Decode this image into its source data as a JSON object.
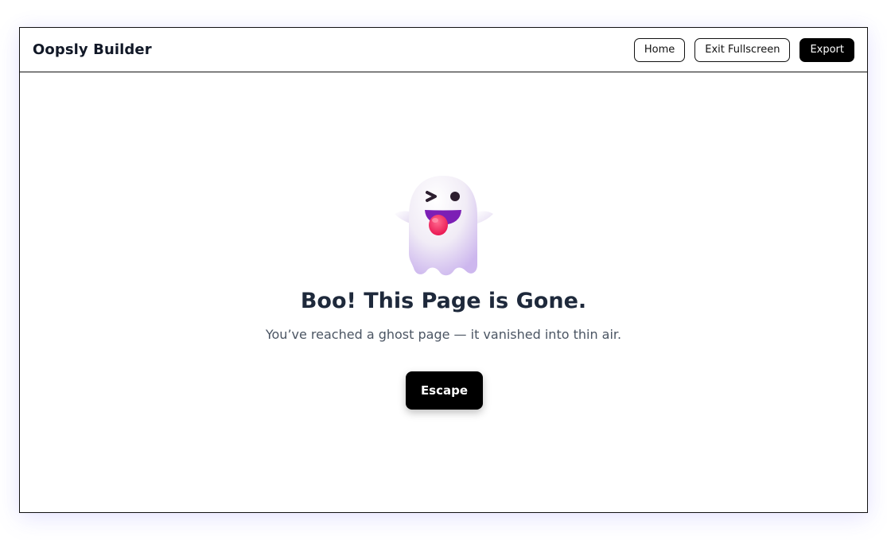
{
  "header": {
    "brand": "Oopsly Builder",
    "nav": {
      "home_label": "Home",
      "exit_fullscreen_label": "Exit Fullscreen",
      "export_label": "Export"
    }
  },
  "main": {
    "illustration_icon": "winking-ghost-icon",
    "title": "Boo! This Page is Gone.",
    "subtitle": "You’ve reached a ghost page — it vanished into thin air.",
    "cta_label": "Escape"
  },
  "colors": {
    "accent": "#000000",
    "title": "#1e293b",
    "subtitle": "#4b5563",
    "ghost_tongue": "#ff2e63",
    "ghost_mouth": "#7c1fb5"
  }
}
